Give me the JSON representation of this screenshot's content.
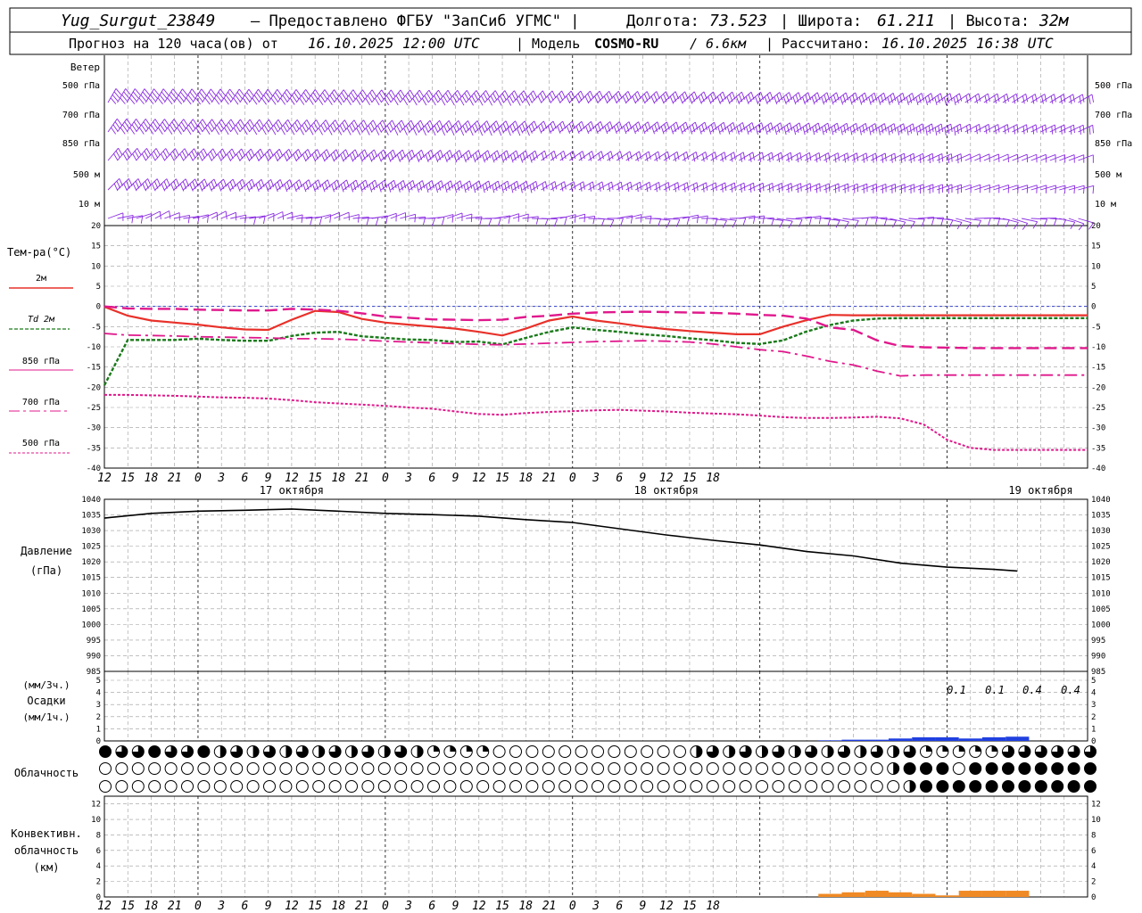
{
  "header": {
    "station": "Yug_Surgut_23849",
    "provider": "— Предоставлено ФГБУ \"ЗапСиб УГМС\" |",
    "lon_label": "Долгота:",
    "lon_value": "73.523",
    "lat_label": "| Широта:",
    "lat_value": "61.211",
    "alt_label": "| Высота:",
    "alt_value": "32м",
    "forecast_label": "Прогноз на 120 часа(ов) от",
    "forecast_start": "16.10.2025 12:00 UTC",
    "model_label": "| Модель",
    "model_name": "COSMO-RU",
    "model_res": "/ 6.6км",
    "calc_label": "| Рассчитано:",
    "calc_time": "16.10.2025 16:38 UTC"
  },
  "time_axis": {
    "hour_labels": [
      "12",
      "15",
      "18",
      "21",
      "0",
      "3",
      "6",
      "9",
      "12",
      "15",
      "18",
      "21",
      "0",
      "3",
      "6",
      "9",
      "12",
      "15",
      "18",
      "21",
      "0",
      "3",
      "6",
      "9",
      "12",
      "15",
      "18"
    ],
    "date_labels": [
      "17 октября",
      "18 октября",
      "19 октября"
    ]
  },
  "wind_panel": {
    "title": "Ветер",
    "levels": [
      "500 гПа",
      "700 гПа",
      "850 гПа",
      "500 м",
      "10  м"
    ],
    "color": "#8a2be2"
  },
  "temp_panel": {
    "title": "Тем-ра(°C)",
    "ticks": [
      "20",
      "15",
      "10",
      "5",
      "0",
      "-5",
      "-10",
      "-15",
      "-20",
      "-25",
      "-30",
      "-35",
      "-40"
    ],
    "legend": [
      {
        "label": "2м",
        "color": "#e8312a"
      },
      {
        "label": "Td  2м",
        "color": "#1a7a1a"
      },
      {
        "label": "850 гПа",
        "color": "#e0188c"
      },
      {
        "label": "700 гПа",
        "color": "#e0188c"
      },
      {
        "label": "500 гПа",
        "color": "#e0188c"
      }
    ]
  },
  "pressure_panel": {
    "title": "Давление",
    "unit": "(гПа)",
    "ticks": [
      "1040",
      "1035",
      "1030",
      "1025",
      "1020",
      "1015",
      "1010",
      "1005",
      "1000",
      "995",
      "990",
      "985"
    ]
  },
  "precip_panel": {
    "unit3": "(мм/3ч.)",
    "title": "Осадки",
    "unit1": "(мм/1ч.)",
    "ticks": [
      "5",
      "4",
      "3",
      "2",
      "1",
      "0"
    ],
    "labels": [
      "0.1",
      "0.1",
      "0.4",
      "0.4"
    ]
  },
  "cloud_panel": {
    "title": "Облачность"
  },
  "conv_panel": {
    "title1": "Конвективн.",
    "title2": "облачность",
    "unit": "(км)",
    "ticks": [
      "12",
      "10",
      "8",
      "6",
      "4",
      "2",
      "0"
    ]
  },
  "chart_data": [
    {
      "type": "line",
      "title": "Тем-ра(°C)",
      "x_hours": [
        0,
        3,
        6,
        9,
        12,
        15,
        18,
        21,
        24,
        27,
        30,
        33,
        36,
        39,
        42,
        45,
        48,
        51,
        54,
        57,
        60,
        63,
        66,
        69,
        72,
        75,
        78,
        81,
        84,
        87,
        90,
        93,
        96,
        99,
        102,
        105,
        108,
        111,
        114,
        117,
        120,
        123,
        126
      ],
      "ylim": [
        -40,
        20
      ],
      "series": [
        {
          "name": "2м",
          "values": [
            -0.1,
            -2.3,
            -3.5,
            -4.0,
            -4.5,
            -5.2,
            -5.7,
            -5.8,
            -3.3,
            -1.1,
            -1.4,
            -3.1,
            -4.0,
            -4.5,
            -5.0,
            -5.5,
            -6.3,
            -7.2,
            -5.5,
            -3.5,
            -2.5,
            -3.5,
            -4.2,
            -5.0,
            -5.6,
            -6.1,
            -6.5,
            -6.9,
            -6.9,
            -5.0,
            -3.4,
            -2.1,
            -2.2,
            -2.2,
            -2.2,
            -2.2,
            -2.2,
            -2.2,
            -2.2,
            -2.2,
            -2.2,
            -2.2,
            -2.2
          ]
        },
        {
          "name": "Td  2м",
          "values": [
            -19.5,
            -8.3,
            -8.3,
            -8.3,
            -8.0,
            -8.3,
            -8.5,
            -8.5,
            -7.3,
            -6.5,
            -6.3,
            -7.4,
            -7.8,
            -8.2,
            -8.3,
            -8.8,
            -8.7,
            -9.4,
            -7.8,
            -6.3,
            -5.2,
            -5.8,
            -6.3,
            -6.9,
            -7.3,
            -7.9,
            -8.4,
            -9.0,
            -9.3,
            -8.4,
            -6.2,
            -4.6,
            -3.5,
            -3.0,
            -2.9,
            -2.9,
            -2.9,
            -2.9,
            -2.9,
            -2.9,
            -2.9,
            -2.9,
            -2.9
          ]
        },
        {
          "name": "850 гПа",
          "values": [
            0.0,
            -0.5,
            -0.6,
            -0.6,
            -0.8,
            -0.9,
            -1.0,
            -1.0,
            -0.6,
            -0.8,
            -1.1,
            -1.7,
            -2.5,
            -2.8,
            -3.2,
            -3.3,
            -3.4,
            -3.3,
            -2.6,
            -2.3,
            -1.8,
            -1.5,
            -1.4,
            -1.3,
            -1.4,
            -1.5,
            -1.6,
            -1.8,
            -2.1,
            -2.3,
            -3.0,
            -5.2,
            -5.8,
            -8.4,
            -9.8,
            -10.1,
            -10.2,
            -10.3,
            -10.3,
            -10.3,
            -10.3,
            -10.3,
            -10.3
          ]
        },
        {
          "name": "700 гПа",
          "values": [
            -6.7,
            -7.1,
            -7.2,
            -7.3,
            -7.5,
            -7.6,
            -7.7,
            -7.8,
            -8.0,
            -8.0,
            -8.1,
            -8.3,
            -8.6,
            -8.8,
            -9.0,
            -9.2,
            -9.4,
            -9.5,
            -9.3,
            -9.1,
            -8.9,
            -8.7,
            -8.6,
            -8.5,
            -8.6,
            -8.8,
            -9.3,
            -10.0,
            -10.7,
            -11.2,
            -12.3,
            -13.6,
            -14.5,
            -16.0,
            -17.2,
            -17.0,
            -17.0,
            -17.0,
            -17.0,
            -17.0,
            -17.0,
            -17.0,
            -17.0
          ]
        },
        {
          "name": "500 гПа",
          "values": [
            -21.9,
            -21.9,
            -22.0,
            -22.1,
            -22.3,
            -22.5,
            -22.6,
            -22.8,
            -23.2,
            -23.7,
            -24.0,
            -24.3,
            -24.6,
            -25.0,
            -25.3,
            -26.0,
            -26.6,
            -26.8,
            -26.4,
            -26.1,
            -25.9,
            -25.7,
            -25.6,
            -25.8,
            -26.0,
            -26.3,
            -26.5,
            -26.7,
            -27.0,
            -27.4,
            -27.6,
            -27.6,
            -27.5,
            -27.3,
            -27.7,
            -29.2,
            -33.0,
            -35.0,
            -35.5,
            -35.5,
            -35.5,
            -35.5,
            -35.5
          ]
        }
      ]
    },
    {
      "type": "line",
      "title": "Давление",
      "x_hours": [
        0,
        6,
        12,
        18,
        24,
        30,
        36,
        42,
        48,
        54,
        60,
        66,
        72,
        78,
        84,
        90,
        96,
        102,
        108,
        114,
        117
      ],
      "ylim": [
        985,
        1040
      ],
      "series": [
        {
          "name": "Давление",
          "values": [
            1034.0,
            1035.5,
            1036.2,
            1036.5,
            1036.9,
            1036.2,
            1035.5,
            1035.1,
            1034.6,
            1033.5,
            1032.6,
            1030.6,
            1028.6,
            1026.9,
            1025.4,
            1023.3,
            1021.9,
            1019.6,
            1018.3,
            1017.6,
            1017.1
          ]
        }
      ]
    },
    {
      "type": "bar",
      "title": "Осадки",
      "x_hours": [
        93,
        96,
        99,
        102,
        105,
        108,
        111,
        114,
        117
      ],
      "ylim": [
        0,
        5
      ],
      "series": [
        {
          "name": "мм/1ч",
          "values": [
            0.05,
            0.1,
            0.1,
            0.2,
            0.3,
            0.3,
            0.2,
            0.3,
            0.35
          ]
        }
      ]
    },
    {
      "type": "bar",
      "title": "Конвективн. облачность",
      "x_hours": [
        93,
        96,
        99,
        102,
        105,
        108,
        111,
        114,
        117
      ],
      "ylim": [
        0,
        13
      ],
      "series": [
        {
          "name": "км",
          "values": [
            0.4,
            0.6,
            0.8,
            0.6,
            0.4,
            0.2,
            0.8,
            0.8,
            0.8
          ]
        }
      ]
    }
  ]
}
